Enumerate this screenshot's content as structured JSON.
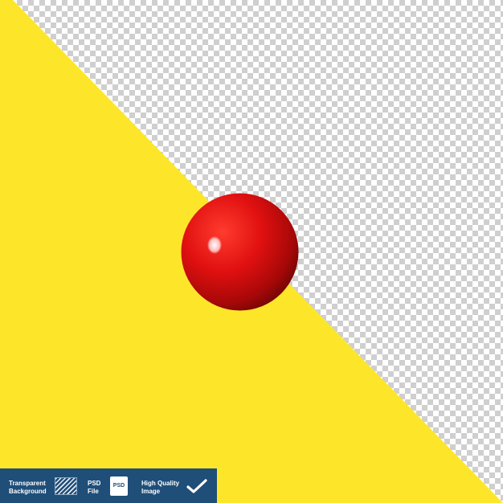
{
  "scene": {
    "subject": "red glossy ball",
    "colors": {
      "yellow": "#fde62a",
      "ball_red": "#d90f0f",
      "checker_dark": "#cfcfcf",
      "checker_light": "#ffffff",
      "badge_bg": "#1f4e79"
    }
  },
  "badge": {
    "transparent_line1": "Transparent",
    "transparent_line2": "Background",
    "transparent_icon": "hatch-pattern-icon",
    "psd_line1": "PSD",
    "psd_line2": "File",
    "psd_icon_label": "PSD",
    "quality_line1": "High Quality",
    "quality_line2": "Image",
    "quality_icon": "checkmark-icon"
  }
}
